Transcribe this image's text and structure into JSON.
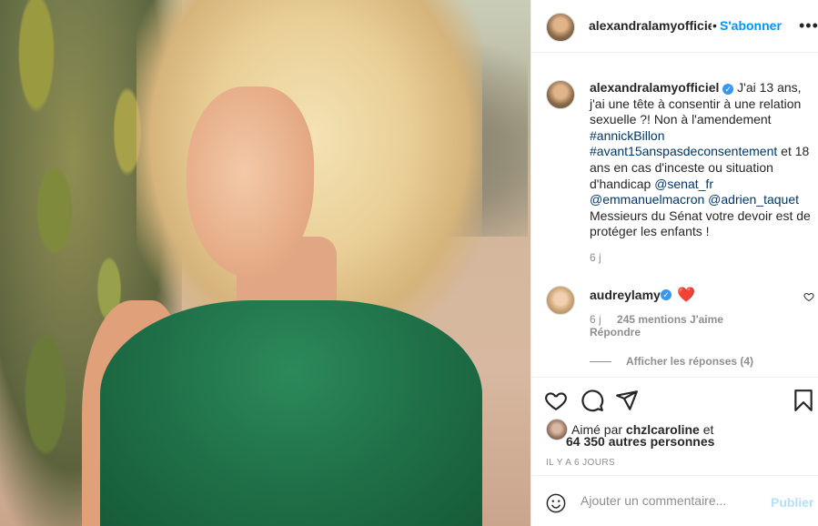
{
  "post": {
    "author": "alexandralamyofficiel",
    "follow_label": "S'abonner",
    "dot": "•",
    "more_label": "•••",
    "caption": {
      "username": "alexandralamyofficiel",
      "part1": " J'ai 13 ans, j'ai une tête à consentir à une relation sexuelle ?! Non à l'amendement ",
      "hashtag1": "#annickBillon",
      "hashtag2": "#avant15anspasdeconsentement",
      "part2": " et 18 ans en cas d'inceste ou situation d'handicap ",
      "mention1": "@senat_fr",
      "mention2": "@emmanuelmacron",
      "mention3": "@adrien_taquet",
      "part3": " Messieurs du Sénat votre devoir est de protéger les enfants !",
      "age": "6 j"
    },
    "verified_mark": "✓"
  },
  "comment": {
    "username": "audreylamy",
    "emoji": "❤️",
    "age": "6 j",
    "likes": "245 mentions J'aime",
    "reply": "Répondre"
  },
  "replies": {
    "label": "Afficher les réponses (4)"
  },
  "likes": {
    "prefix": "Aimé par ",
    "liker": "chzlcaroline",
    "and": " et",
    "others": "64 350 autres personnes",
    "ago": "IL Y A 6 JOURS"
  },
  "comment_box": {
    "placeholder": "Ajouter un commentaire...",
    "publish": "Publier"
  },
  "colors": {
    "accent": "#0095f6",
    "verified": "#3897f0",
    "link": "#00376b",
    "muted": "#8e8e8e"
  }
}
